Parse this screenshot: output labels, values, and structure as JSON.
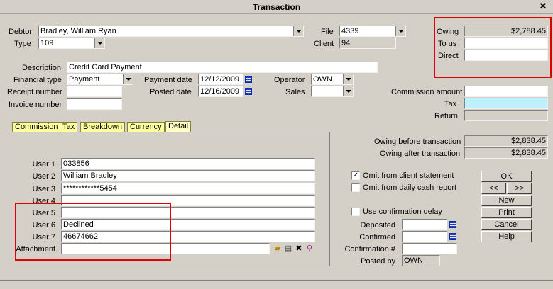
{
  "window": {
    "title": "Transaction"
  },
  "header": {
    "debtor_label": "Debtor",
    "debtor_value": "Bradley, William Ryan",
    "type_label": "Type",
    "type_value": "109",
    "file_label": "File",
    "file_value": "4339",
    "client_label": "Client",
    "client_value": "94"
  },
  "owing": {
    "owing_label": "Owing",
    "owing_value": "$2,788.45",
    "to_us_label": "To us",
    "to_us_value": "",
    "direct_label": "Direct",
    "direct_value": ""
  },
  "details": {
    "description_label": "Description",
    "description_value": "Credit Card Payment",
    "financial_type_label": "Financial type",
    "financial_type_value": "Payment",
    "payment_date_label": "Payment date",
    "payment_date_value": "12/12/2009",
    "operator_label": "Operator",
    "operator_value": "OWN",
    "receipt_number_label": "Receipt number",
    "receipt_number_value": "",
    "posted_date_label": "Posted date",
    "posted_date_value": "12/16/2009",
    "sales_label": "Sales",
    "sales_value": "",
    "invoice_number_label": "Invoice number",
    "invoice_number_value": ""
  },
  "commission": {
    "commission_amount_label": "Commission amount",
    "commission_amount_value": "",
    "tax_label": "Tax",
    "tax_value": "",
    "return_label": "Return",
    "return_value": ""
  },
  "tabs": [
    {
      "label": "Commission"
    },
    {
      "label": "Tax"
    },
    {
      "label": "Breakdown"
    },
    {
      "label": "Currency"
    },
    {
      "label": "Detail"
    }
  ],
  "detail_panel": {
    "user1_label": "User 1",
    "user1_value": "033856",
    "user2_label": "User 2",
    "user2_value": "William Bradley",
    "user3_label": "User 3",
    "user3_value": "************5454",
    "user4_label": "User 4",
    "user4_value": "",
    "user5_label": "User 5",
    "user5_value": "",
    "user6_label": "User 6",
    "user6_value": "Declined",
    "user7_label": "User 7",
    "user7_value": "46674662",
    "attachment_label": "Attachment",
    "attachment_value": ""
  },
  "balances": {
    "before_label": "Owing before transaction",
    "before_value": "$2,838.45",
    "after_label": "Owing after transaction",
    "after_value": "$2,838.45"
  },
  "options": {
    "omit_client_statement_label": "Omit from client statement",
    "omit_client_statement_checked": true,
    "omit_daily_cash_label": "Omit from daily cash report",
    "omit_daily_cash_checked": false,
    "use_confirmation_delay_label": "Use confirmation delay",
    "use_confirmation_delay_checked": false,
    "deposited_label": "Deposited",
    "deposited_value": "",
    "confirmed_label": "Confirmed",
    "confirmed_value": "",
    "confirmation_num_label": "Confirmation #",
    "confirmation_num_value": "",
    "posted_by_label": "Posted by",
    "posted_by_value": "OWN"
  },
  "buttons": {
    "ok": "OK",
    "prev": "<<",
    "next": ">>",
    "new": "New",
    "print": "Print",
    "cancel": "Cancel",
    "help": "Help"
  },
  "colors": {
    "highlight_box": "#e00000",
    "tax_field": "#bff0ff",
    "tab_bg": "#ffffa0"
  }
}
